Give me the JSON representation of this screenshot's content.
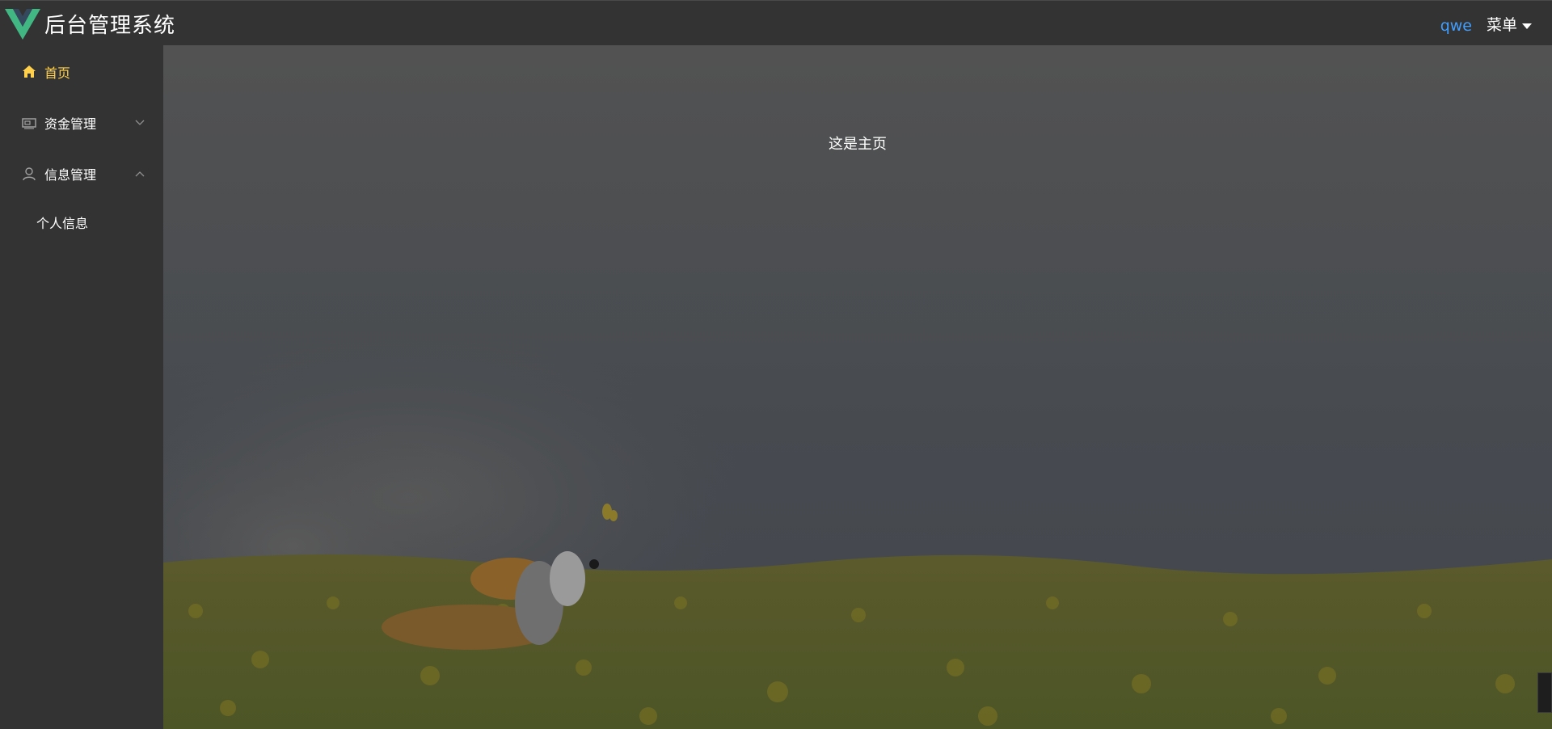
{
  "header": {
    "app_title": "后台管理系统",
    "username": "qwe",
    "menu_label": "菜单",
    "logo_icon": "vue-logo-icon",
    "username_color": "#409eff"
  },
  "sidebar": {
    "active_color": "#ffd04b",
    "items": [
      {
        "label": "首页",
        "icon": "home-icon",
        "active": true
      },
      {
        "label": "资金管理",
        "icon": "money-icon",
        "expanded": false
      },
      {
        "label": "信息管理",
        "icon": "user-icon",
        "expanded": true,
        "children": [
          {
            "label": "个人信息"
          }
        ]
      }
    ]
  },
  "main": {
    "text": "这是主页"
  }
}
